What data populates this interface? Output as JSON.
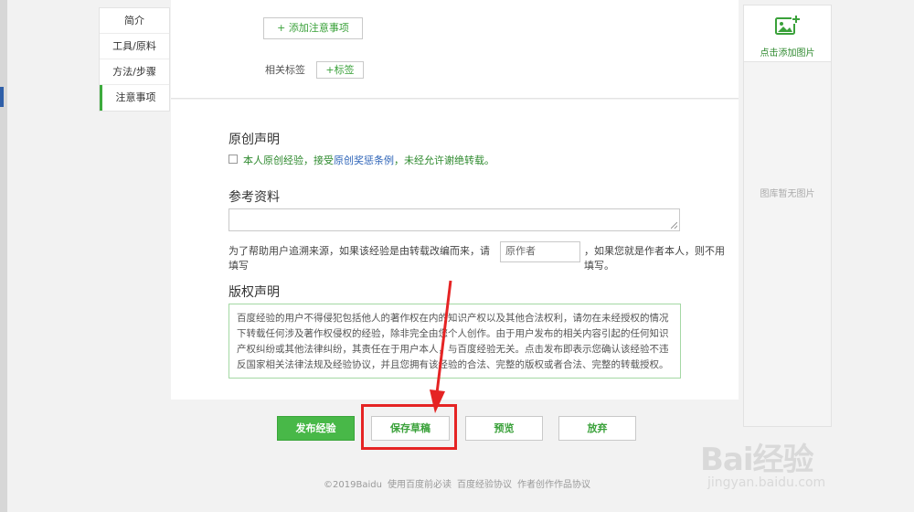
{
  "nav": {
    "items": [
      {
        "label": "简介",
        "active": false
      },
      {
        "label": "工具/原料",
        "active": false
      },
      {
        "label": "方法/步骤",
        "active": false
      },
      {
        "label": "注意事项",
        "active": true
      }
    ]
  },
  "top": {
    "add_note_label": "+ 添加注意事项",
    "tags_label": "相关标签",
    "add_tag_label": "+标签"
  },
  "original": {
    "heading": "原创声明",
    "text_before": "本人原创经验，接受",
    "link": "原创奖惩条例",
    "text_after": "，未经允许谢绝转载。",
    "checked": false
  },
  "reference": {
    "heading": "参考资料",
    "value": "",
    "note_before": "为了帮助用户追溯来源，如果该经验是由转载改编而来，请填写",
    "author_placeholder": "原作者",
    "note_after": "，如果您就是作者本人，则不用填写。"
  },
  "copyright": {
    "heading": "版权声明",
    "text": "百度经验的用户不得侵犯包括他人的著作权在内的知识产权以及其他合法权利，请勿在未经授权的情况下转载任何涉及著作权侵权的经验，除非完全由您个人创作。由于用户发布的相关内容引起的任何知识产权纠纷或其他法律纠纷，其责任在于用户本人，与百度经验无关。点击发布即表示您确认该经验不违反国家相关法律法规及经验协议，并且您拥有该经验的合法、完整的版权或者合法、完整的转载授权。"
  },
  "right_panel": {
    "add_image_label": "点击添加图片",
    "empty_text": "图库暂无图片"
  },
  "actions": {
    "publish": "发布经验",
    "save_draft": "保存草稿",
    "preview": "预览",
    "discard": "放弃"
  },
  "footer": {
    "copyright": "©2019Baidu",
    "links": [
      "使用百度前必读",
      "百度经验协议",
      "作者创作作品协议"
    ]
  },
  "watermark": {
    "logo_text": "Bai经验",
    "url": "jingyan.baidu.com"
  },
  "colors": {
    "accent_green": "#48b848",
    "highlight_red": "#e52424",
    "link_blue": "#2e64b8"
  }
}
